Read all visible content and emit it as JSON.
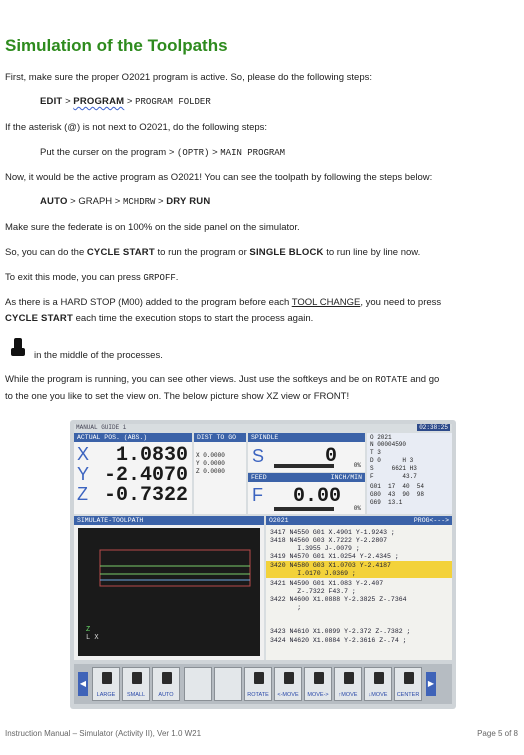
{
  "title": "Simulation of the Toolpaths",
  "p1": "First, make sure the proper O2021 program is active. So, please do the following steps:",
  "step1": {
    "edit": "EDIT",
    "gt1": " > ",
    "program": "PROGRAM",
    "gt2": " > ",
    "folder": "PROGRAM FOLDER"
  },
  "p2": "If the asterisk (@) is not next to O2021, do the following steps:",
  "step2": {
    "text": "Put the curser on the program > ",
    "optr": "(OPTR)",
    "gt": " > ",
    "main": "MAIN PROGRAM"
  },
  "p3": "Now, it would be the active program as O2021! You can see the toolpath by following the steps below:",
  "step3": {
    "auto": "AUTO",
    "gt1": " > ",
    "graph": "GRAPH",
    "gt2": " > ",
    "mchdrw": "MCHDRW",
    "gt3": " > ",
    "dryrun": "DRY RUN"
  },
  "p4": "Make sure the federate is on 100% on the side panel on the simulator.",
  "p5": {
    "a": "So, you can do the ",
    "b": "CYCLE START",
    "c": " to run the program or ",
    "d": "SINGLE BLOCK",
    "e": " to run line by line now."
  },
  "p6": {
    "a": "To exit this mode, you can press ",
    "b": "GRPOFF",
    "c": "."
  },
  "p7": {
    "a": "As there is a HARD STOP (M00) added to the program before each ",
    "b": "TOOL CHANGE",
    "c": ", you need to press"
  },
  "p8": {
    "a": "CYCLE START",
    "b": " each time the execution stops to start the process again."
  },
  "p9": "in the middle of the processes.",
  "p10": {
    "a": "While the program is running, you can see other views. Just use the softkeys and be on ",
    "b": "ROTATE",
    "c": " and go"
  },
  "p11": "to the one you like to set the view on. The below picture show XZ view or FRONT!",
  "screen": {
    "mode": "MANUAL GUIDE i",
    "time": "02:38:25",
    "actual_pos": "ACTUAL POS. (ABS.)",
    "dist_to_go": "DIST TO GO",
    "spindle": "SPINDLE",
    "axes": [
      {
        "axis": "X",
        "value": "1.0830",
        "dtg": "0.0000"
      },
      {
        "axis": "Y",
        "value": "-2.4070",
        "dtg": "0.0000"
      },
      {
        "axis": "Z",
        "value": "-0.7322",
        "dtg": "0.0000"
      }
    ],
    "spindle_val": "0",
    "s_label": "S",
    "feed_label": "FEED",
    "feed_units": "INCH/MIN",
    "f_label": "F",
    "feed_val": "0.00",
    "pct1": "0%",
    "pct2": "0%",
    "modal": [
      "O 2021",
      "N 00004590",
      "T 3",
      "D 0      H 3",
      "S     6621 H3",
      "F        43.7",
      "G01  17  40  54",
      "G80  43  90  98",
      "G69  13.1"
    ],
    "sim_title": "SIMULATE-TOOLPATH",
    "axis_z": "Z",
    "axis_x": "L X",
    "prog_title": "O2021",
    "prog_tag": "PROG<--->",
    "prog_lines": [
      "3417 N4550 G01 X.4901 Y-1.9243 ;",
      "3418 N4560 G03 X.7222 Y-2.2807",
      "       I.3955 J-.0079 ;",
      "3419 N4570 G01 X1.0254 Y-2.4345 ;",
      "3420 N4580 G03 X1.0703 Y-2.4187",
      "       I.0170 J.0369 ;",
      "3421 N4590 G01 X1.083 Y-2.407",
      "       Z-.7322 F43.7 ;",
      "3422 N4600 X1.0888 Y-2.3825 Z-.7364",
      "       ;",
      "3423 N4610 X1.0899 Y-2.372 Z-.7382 ;",
      "3424 N4620 X1.0884 Y-2.3616 Z-.74 ;"
    ],
    "softkeys": [
      "LARGE",
      "SMALL",
      "AUTO",
      "",
      "",
      "ROTATE",
      "<-MOVE",
      "MOVE->",
      "↑MOVE",
      "↓MOVE",
      "CENTER"
    ]
  },
  "footer_left": "Instruction Manual – Simulator (Activity II), Ver 1.0 W21",
  "footer_right": "Page 5 of 8"
}
